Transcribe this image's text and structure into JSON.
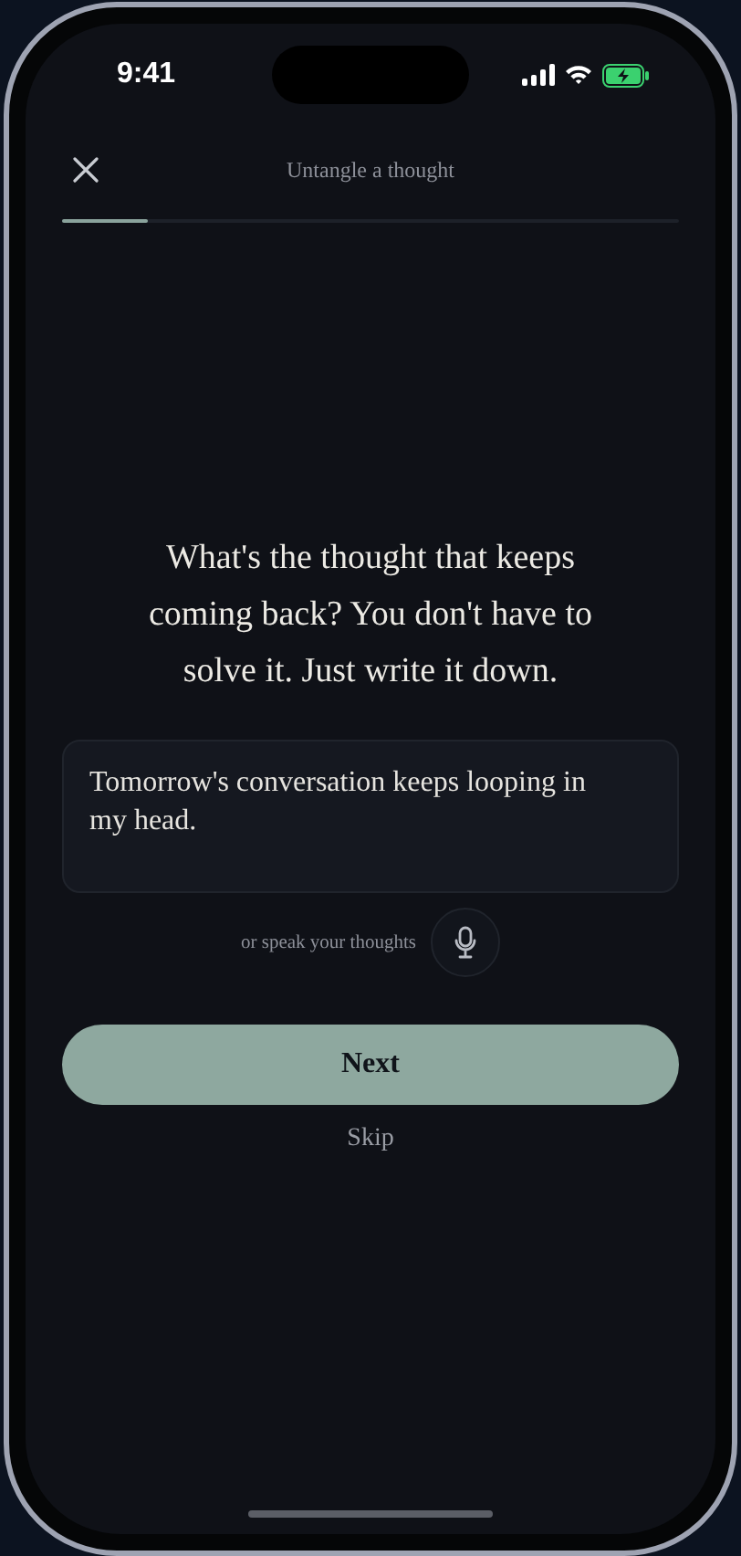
{
  "status_bar": {
    "time": "9:41"
  },
  "header": {
    "title": "Untangle a thought"
  },
  "progress": {
    "level": 0.14
  },
  "prompt": "What's the thought that keeps coming back? You don't have to solve it. Just write it down.",
  "entry": {
    "value": "Tomorrow's conversation keeps looping in my head."
  },
  "voice": {
    "label": "or speak your thoughts"
  },
  "primary_button": {
    "label": "Next"
  },
  "secondary_link": {
    "label": "Skip"
  }
}
